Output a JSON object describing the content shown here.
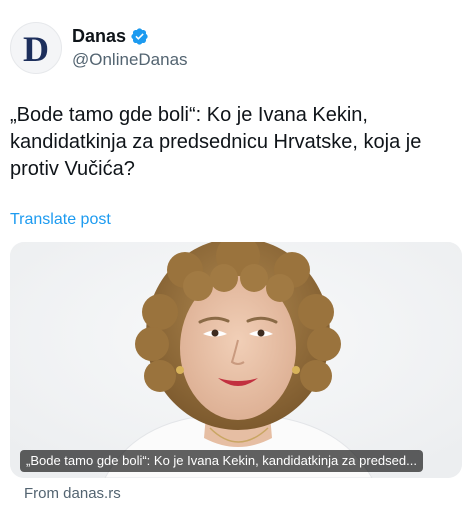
{
  "account": {
    "avatar_letter": "D",
    "display_name": "Danas",
    "handle": "@OnlineDanas",
    "verified_icon": "verified-badge-icon",
    "verified_color": "#1d9bf0"
  },
  "post": {
    "text": "„Bode tamo gde boli“: Ko je Ivana Kekin, kandidatkinja za predsednicu Hrvatske, koja je protiv Vučića?",
    "translate_label": "Translate post"
  },
  "link_card": {
    "caption": "„Bode tamo gde boli“: Ko je Ivana Kekin, kandidatkinja za predsed...",
    "source": "From danas.rs"
  },
  "colors": {
    "link": "#1d9bf0",
    "secondary_text": "#536471",
    "brand_navy": "#1d2f5c"
  }
}
